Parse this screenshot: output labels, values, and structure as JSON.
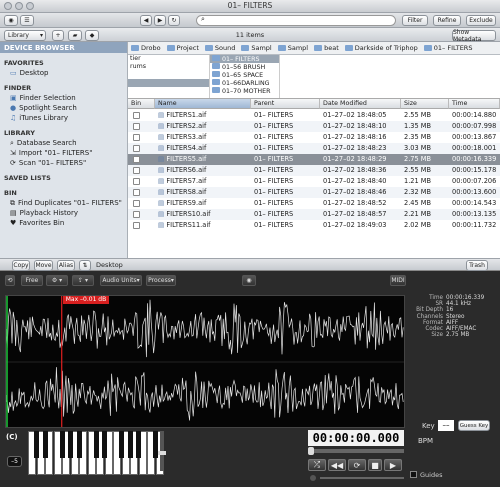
{
  "window": {
    "title": "01– FILTERS"
  },
  "toolbar": {
    "filter": "Filter",
    "refine": "Refine",
    "exclude": "Exclude",
    "search_icon": "search-icon"
  },
  "bar2": {
    "library": "Library",
    "count": "11 items",
    "show_metadata": "Show Metadata"
  },
  "sidebar": {
    "device_browser": "DEVICE BROWSER",
    "sections": [
      {
        "title": "FAVORITES",
        "items": [
          "Desktop"
        ]
      },
      {
        "title": "FINDER",
        "items": [
          "Finder Selection",
          "Spotlight Search",
          "iTunes Library"
        ]
      },
      {
        "title": "LIBRARY",
        "items": [
          "Database Search",
          "Import \"01– FILTERS\"",
          "Scan \"01– FILTERS\""
        ]
      },
      {
        "title": "SAVED LISTS",
        "items": []
      },
      {
        "title": "BIN",
        "items": [
          "Find Duplicates \"01– FILTERS\"",
          "Playback History",
          "Favorites Bin"
        ]
      }
    ]
  },
  "breadcrumbs": [
    "Drobo",
    "Project",
    "Sound",
    "Sampl",
    "Sampl",
    "beat",
    "Darkside of Triphop",
    "01– FILTERS"
  ],
  "columns": {
    "col1": [
      "tier",
      "rums",
      "",
      ""
    ],
    "col2": [
      "01– FILTERS",
      "01–56 BRUSH",
      "01–65 SPACE",
      "01–66DARLING",
      "01–70 MOTHER"
    ]
  },
  "table": {
    "headers": [
      "Bin",
      "Name",
      "Parent",
      "Date Modified",
      "Size",
      "Time"
    ],
    "rows": [
      [
        "FILTERS1.aif",
        "01– FILTERS",
        "01–27–02 18:48:05",
        "2.55 MB",
        "00:00:14.880"
      ],
      [
        "FILTERS2.aif",
        "01– FILTERS",
        "01–27–02 18:48:10",
        "1.35 MB",
        "00:00:07.998"
      ],
      [
        "FILTERS3.aif",
        "01– FILTERS",
        "01–27–02 18:48:16",
        "2.35 MB",
        "00:00:13.867"
      ],
      [
        "FILTERS4.aif",
        "01– FILTERS",
        "01–27–02 18:48:23",
        "3.03 MB",
        "00:00:18.001"
      ],
      [
        "FILTERS5.aif",
        "01– FILTERS",
        "01–27–02 18:48:29",
        "2.75 MB",
        "00:00:16.339"
      ],
      [
        "FILTERS6.aif",
        "01– FILTERS",
        "01–27–02 18:48:36",
        "2.55 MB",
        "00:00:15.178"
      ],
      [
        "FILTERS7.aif",
        "01– FILTERS",
        "01–27–02 18:48:40",
        "1.21 MB",
        "00:00:07.206"
      ],
      [
        "FILTERS8.aif",
        "01– FILTERS",
        "01–27–02 18:48:46",
        "2.32 MB",
        "00:00:13.600"
      ],
      [
        "FILTERS9.aif",
        "01– FILTERS",
        "01–27–02 18:48:52",
        "2.45 MB",
        "00:00:14.543"
      ],
      [
        "FILTERS10.aif",
        "01– FILTERS",
        "01–27–02 18:48:57",
        "2.21 MB",
        "00:00:13.135"
      ],
      [
        "FILTERS11.aif",
        "01– FILTERS",
        "01–27–02 18:49:03",
        "2.02 MB",
        "00:00:11.732"
      ]
    ],
    "selected_row": 4
  },
  "bottombar": {
    "copy": "Copy",
    "move": "Move",
    "alias": "Alias",
    "location": "Desktop",
    "trash": "Trash"
  },
  "player": {
    "free": "Free",
    "audio_units": "Audio Units",
    "process": "Process",
    "midi": "MIDI",
    "marker": "Max –0.01 dB",
    "info": [
      [
        "Time",
        "00:00:16.339"
      ],
      [
        "SR",
        "44.1 kHz"
      ],
      [
        "Bit Depth",
        "16"
      ],
      [
        "Channels",
        "Stereo"
      ],
      [
        "Format",
        "AIFF"
      ],
      [
        "Codec",
        "AIFF/EMAC"
      ],
      [
        "Size",
        "2.75 MB"
      ]
    ],
    "key_label": "Key",
    "key_value": "––",
    "guess_key": "Guess Key",
    "bpm": "BPM",
    "octave": "(C)",
    "transpose": "–5",
    "timer": "00:00:00.000",
    "guides": "Guides",
    "playhead": 0.14
  }
}
